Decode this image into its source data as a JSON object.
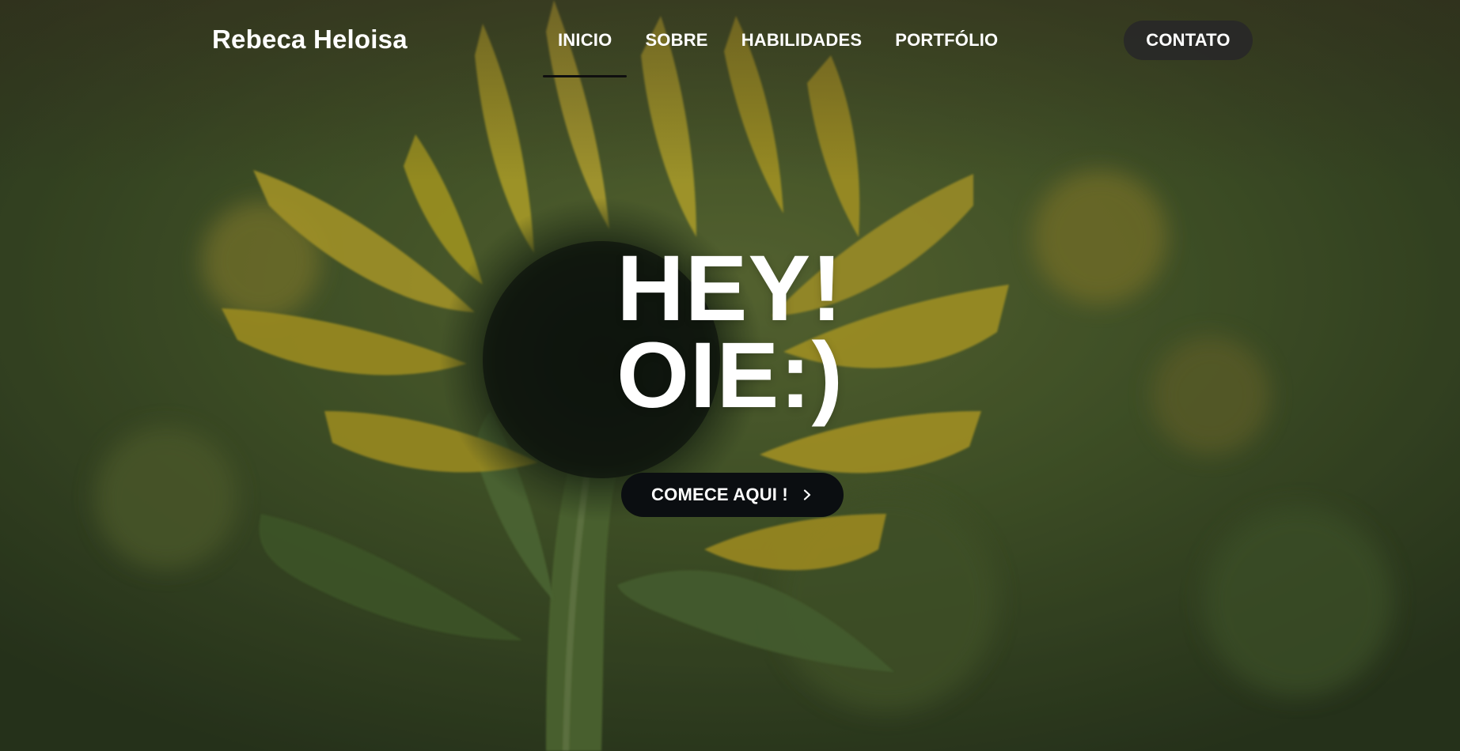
{
  "nav": {
    "brand": "Rebeca Heloisa",
    "items": [
      {
        "label": "INICIO",
        "active": true
      },
      {
        "label": "SOBRE",
        "active": false
      },
      {
        "label": "HABILIDADES",
        "active": false
      },
      {
        "label": "PORTFÓLIO",
        "active": false
      }
    ],
    "contact_label": "CONTATO"
  },
  "hero": {
    "title_line_1": "HEY!",
    "title_line_2": "OIE:)",
    "cta_label": "COMECE AQUI !",
    "cta_icon": "chevron-right-icon"
  },
  "theme": {
    "nav_active_underline": "#0f0f0f",
    "cta_background": "#0b0e11",
    "contact_background": "#282828"
  }
}
